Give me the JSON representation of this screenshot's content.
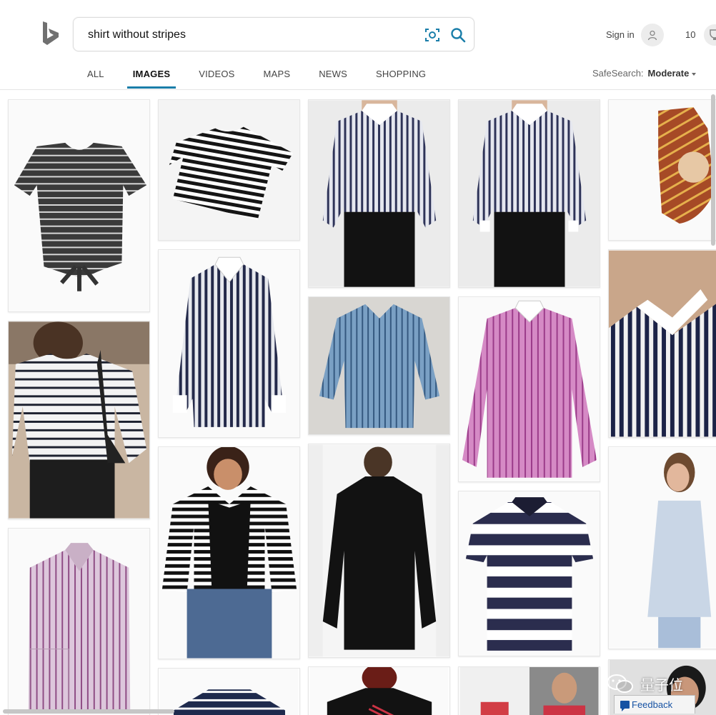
{
  "search": {
    "query": "shirt without stripes",
    "placeholder": ""
  },
  "header": {
    "sign_in": "Sign in",
    "rewards_count": "10"
  },
  "nav": {
    "tabs": [
      {
        "label": "ALL"
      },
      {
        "label": "IMAGES"
      },
      {
        "label": "VIDEOS"
      },
      {
        "label": "MAPS"
      },
      {
        "label": "NEWS"
      },
      {
        "label": "SHOPPING"
      }
    ],
    "active": "IMAGES"
  },
  "safesearch": {
    "label": "SafeSearch:",
    "value": "Moderate"
  },
  "watermark": {
    "text": "量子位"
  },
  "feedback": {
    "label": "Feedback"
  },
  "colors": {
    "accent": "#1a7ea9",
    "logo": "#6b6b6b",
    "feedback_link": "#1652a3"
  }
}
